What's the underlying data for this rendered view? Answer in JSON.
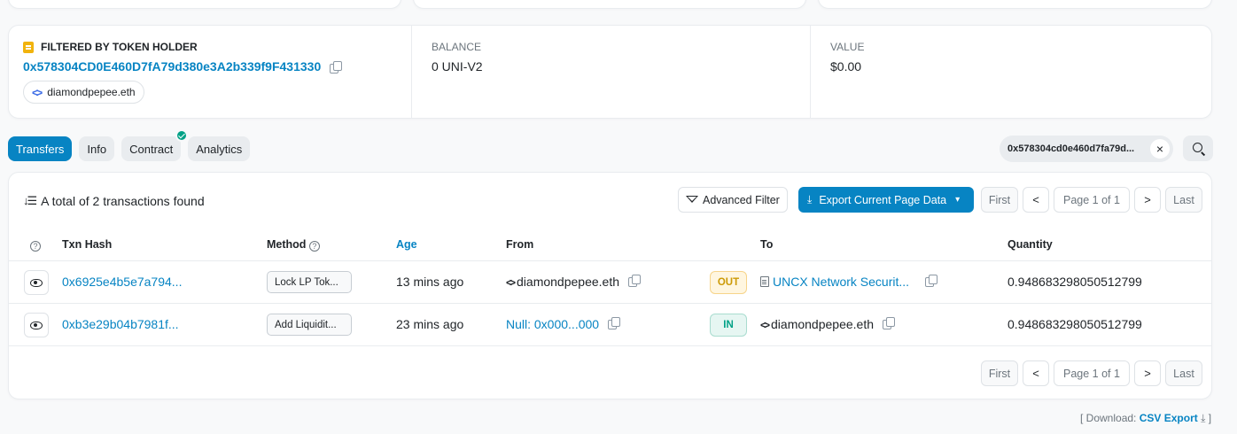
{
  "holder": {
    "title": "FILTERED BY TOKEN HOLDER",
    "address": "0x578304CD0E460D7fA79d380e3A2b339f9F431330",
    "ens": "diamondpepee.eth",
    "balance_label": "BALANCE",
    "balance_value": "0 UNI-V2",
    "value_label": "VALUE",
    "value_value": "$0.00"
  },
  "tabs": [
    {
      "label": "Transfers",
      "active": true
    },
    {
      "label": "Info",
      "active": false
    },
    {
      "label": "Contract",
      "active": false,
      "verified": true
    },
    {
      "label": "Analytics",
      "active": false
    }
  ],
  "filter_pill": {
    "text": "0x578304cd0e460d7fa79d...",
    "clear": "×"
  },
  "summary": "A total of 2 transactions found",
  "advanced_filter": "Advanced Filter",
  "export_button": "Export Current Page Data",
  "pager": {
    "first": "First",
    "prev": "<",
    "page": "Page 1 of 1",
    "next": ">",
    "last": "Last"
  },
  "table": {
    "headers": {
      "help": "?",
      "txn_hash": "Txn Hash",
      "method": "Method",
      "age": "Age",
      "from": "From",
      "to": "To",
      "quantity": "Quantity"
    },
    "rows": [
      {
        "txn_hash": "0x6925e4b5e7a794...",
        "method": "Lock LP Tok...",
        "age": "13 mins ago",
        "from": "diamondpepee.eth",
        "direction": "OUT",
        "to": "UNCX Network Securit...",
        "quantity": "0.948683298050512799"
      },
      {
        "txn_hash": "0xb3e29b04b7981f...",
        "method": "Add Liquidit...",
        "age": "23 mins ago",
        "from": "Null: 0x000...000",
        "direction": "IN",
        "to": "diamondpepee.eth",
        "quantity": "0.948683298050512799"
      }
    ]
  },
  "footer": {
    "prefix": "[ Download:",
    "link": "CSV Export",
    "suffix": "]"
  },
  "colors": {
    "primary": "#0784c3",
    "out_badge": "#cc9a06",
    "in_badge": "#00a186",
    "token_icon": "#f1b30d"
  }
}
